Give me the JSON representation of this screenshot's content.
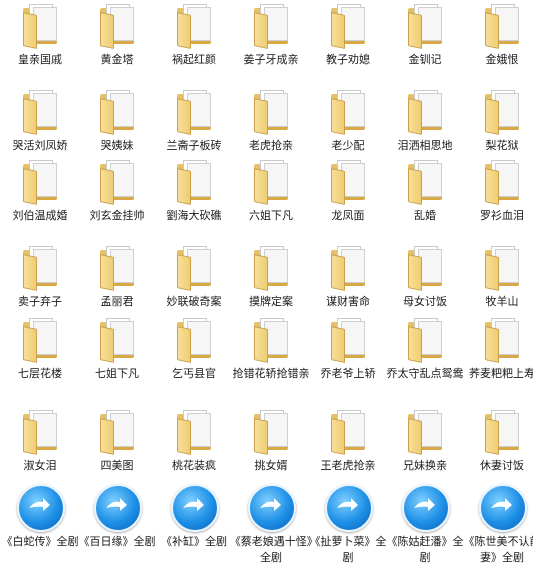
{
  "items": [
    {
      "label": "皇亲国戚",
      "type": "folder"
    },
    {
      "label": "黄金塔",
      "type": "folder"
    },
    {
      "label": "祸起红颜",
      "type": "folder"
    },
    {
      "label": "姜子牙成亲",
      "type": "folder"
    },
    {
      "label": "教子劝媳",
      "type": "folder"
    },
    {
      "label": "金钏记",
      "type": "folder"
    },
    {
      "label": "金娥恨",
      "type": "folder"
    },
    {
      "label": "哭活刘凤娇",
      "type": "folder"
    },
    {
      "label": "哭姨妹",
      "type": "folder"
    },
    {
      "label": "兰斋子板砖",
      "type": "folder"
    },
    {
      "label": "老虎抢亲",
      "type": "folder"
    },
    {
      "label": "老少配",
      "type": "folder"
    },
    {
      "label": "泪洒相思地",
      "type": "folder"
    },
    {
      "label": "梨花狱",
      "type": "folder"
    },
    {
      "label": "刘伯温成婚",
      "type": "folder"
    },
    {
      "label": "刘玄金挂帅",
      "type": "folder"
    },
    {
      "label": "劉海大砍礁",
      "type": "folder"
    },
    {
      "label": "六姐下凡",
      "type": "folder"
    },
    {
      "label": "龙凤面",
      "type": "folder"
    },
    {
      "label": "乱婚",
      "type": "folder"
    },
    {
      "label": "罗衫血泪",
      "type": "folder"
    },
    {
      "label": "卖子弃子",
      "type": "folder"
    },
    {
      "label": "孟丽君",
      "type": "folder"
    },
    {
      "label": "妙联破奇案",
      "type": "folder"
    },
    {
      "label": "摸牌定案",
      "type": "folder"
    },
    {
      "label": "谋财害命",
      "type": "folder"
    },
    {
      "label": "母女讨饭",
      "type": "folder"
    },
    {
      "label": "牧羊山",
      "type": "folder"
    },
    {
      "label": "七层花楼",
      "type": "folder"
    },
    {
      "label": "七姐下凡",
      "type": "folder"
    },
    {
      "label": "乞丐县官",
      "type": "folder"
    },
    {
      "label": "抢错花轿抢错亲",
      "type": "folder"
    },
    {
      "label": "乔老爷上轿",
      "type": "folder"
    },
    {
      "label": "乔太守乱点鸳鸯",
      "type": "folder"
    },
    {
      "label": "荞麦粑粑上寿",
      "type": "folder"
    },
    {
      "label": "淑女泪",
      "type": "folder"
    },
    {
      "label": "四美图",
      "type": "folder"
    },
    {
      "label": "桃花装疯",
      "type": "folder"
    },
    {
      "label": "挑女婿",
      "type": "folder"
    },
    {
      "label": "王老虎抢亲",
      "type": "folder"
    },
    {
      "label": "兄妹换亲",
      "type": "folder"
    },
    {
      "label": "休妻讨饭",
      "type": "folder"
    },
    {
      "label": "《白蛇传》全剧",
      "type": "media"
    },
    {
      "label": "《百日缘》全剧",
      "type": "media"
    },
    {
      "label": "《补缸》全剧",
      "type": "media"
    },
    {
      "label": "《蔡老娘遇十怪》全剧",
      "type": "media"
    },
    {
      "label": "《扯萝卜菜》全剧",
      "type": "media"
    },
    {
      "label": "《陈姑赶潘》全剧",
      "type": "media"
    },
    {
      "label": "《陈世美不认前妻》全剧",
      "type": "media"
    }
  ]
}
